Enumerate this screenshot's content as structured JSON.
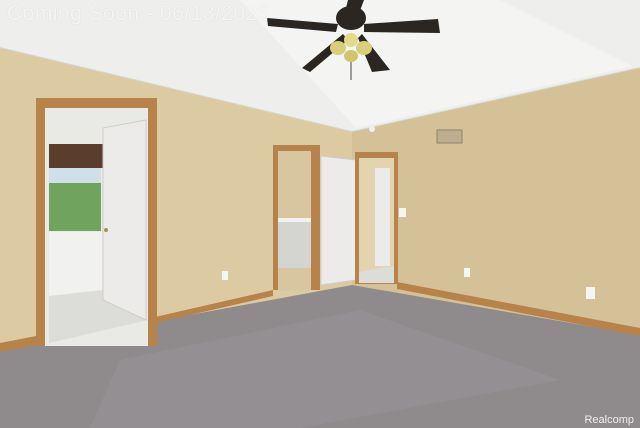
{
  "watermark": {
    "text": "Coming Soon - 06/13/2025"
  },
  "credit": {
    "text": "Realcomp"
  },
  "colors": {
    "wall": "#dccaa3",
    "wall_shade": "#d4c197",
    "ceiling": "#eeeeec",
    "carpet": "#8f8b8d",
    "trim": "#b8834a",
    "door": "#ecebea",
    "tile": "#dcdcd8",
    "fan": "#2a2622",
    "fan_light": "#d7cf7a"
  }
}
